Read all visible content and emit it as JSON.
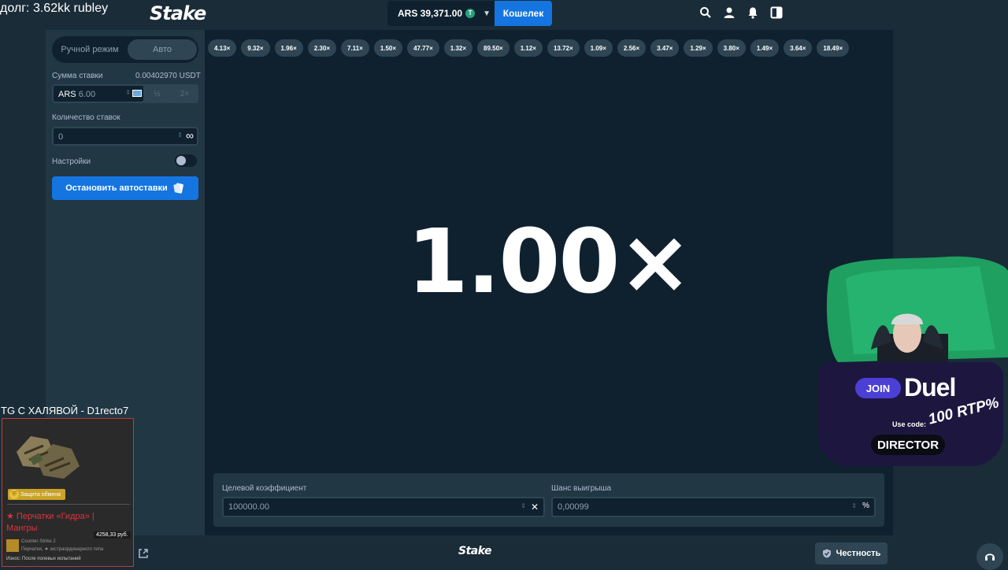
{
  "overlay": {
    "debt_text": "долг: 3.62kk rubley",
    "tg_text": "TG С ХАЛЯВОЙ - D1recto7"
  },
  "header": {
    "logo": "Stake",
    "balance_text": "ARS 39,371.00",
    "coin_symbol": "T",
    "wallet_label": "Кошелек",
    "icons": [
      "search-icon",
      "user-icon",
      "bell-icon",
      "sidebar-icon"
    ]
  },
  "sidebar": {
    "mode_manual": "Ручной режим",
    "mode_auto": "Авто",
    "bet_amount_label": "Сумма ставки",
    "bet_amount_usdt": "0.00402970 USDT",
    "bet_currency": "ARS",
    "bet_value": "6.00",
    "half_label": "½",
    "double_label": "2×",
    "bets_count_label": "Количество ставок",
    "bets_count_value": "0",
    "infinity_symbol": "∞",
    "settings_label": "Настройки",
    "stop_autobet_label": "Остановить автоставки"
  },
  "game": {
    "history": [
      "4.13×",
      "9.32×",
      "1.96×",
      "2.30×",
      "7.11×",
      "1.50×",
      "47.77×",
      "1.32×",
      "89.50×",
      "1.12×",
      "13.72×",
      "1.09×",
      "2.56×",
      "3.47×",
      "1.29×",
      "3.80×",
      "1.49×",
      "3.64×",
      "18.49×"
    ],
    "multiplier": "1.00×",
    "target_label": "Целевой коэффициент",
    "target_value": "100000.00",
    "target_suffix": "✕",
    "chance_label": "Шанс выигрыша",
    "chance_value": "0,00099",
    "chance_suffix": "%"
  },
  "footer": {
    "logo": "Stake",
    "fairness_label": "Честность"
  },
  "trade_card": {
    "badge": "Защита обмена",
    "item_name": "★ Перчатки «Гидра» | Мангры",
    "price": "4258,33 руб.",
    "game": "Counter-Strike 2",
    "category": "Перчатки, ★ экстраординарного типа",
    "wear": "Износ: После полевых испытаний"
  },
  "promo": {
    "join": "JOIN",
    "brand": "Duel",
    "rtp": "100 RTP%",
    "use_code": "Use code:",
    "code": "DIRECTOR"
  },
  "colors": {
    "background": "#1a2c38",
    "panel": "#213743",
    "game_bg": "#0f212e",
    "accent_blue": "#1475e1"
  }
}
